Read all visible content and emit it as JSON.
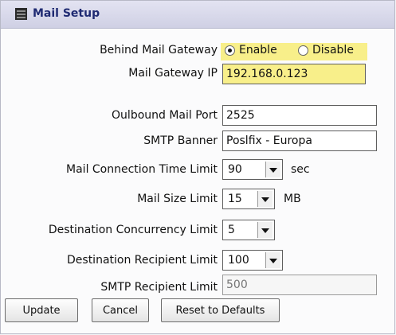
{
  "header": {
    "title": "Mail Setup",
    "icon": "mail-setup-icon"
  },
  "gateway": {
    "label": "Behind Mail Gateway",
    "enable_label": "Enable",
    "disable_label": "Disable",
    "selected": "Enable"
  },
  "fields": {
    "gateway_ip": {
      "label": "Mail Gateway IP",
      "value": "192.168.0.123"
    },
    "outbound_port": {
      "label": "Oulbound Mail Port",
      "value": "2525"
    },
    "smtp_banner": {
      "label": "SMTP Banner",
      "value": "Poslfix - Europa"
    },
    "conn_time": {
      "label": "Mail Connection Time Limit",
      "value": "90",
      "unit": "sec"
    },
    "size_limit": {
      "label": "Mail Size Limit",
      "value": "15",
      "unit": "MB"
    },
    "dest_concurrency": {
      "label": "Destination Concurrency Limit",
      "value": "5"
    },
    "dest_recipient": {
      "label": "Destination Recipient Limit",
      "value": "100"
    },
    "smtp_recipient": {
      "label": "SMTP Recipient Limit",
      "placeholder": "500"
    }
  },
  "buttons": {
    "update": "Update",
    "cancel": "Cancel",
    "reset": "Reset to Defaults"
  },
  "colors": {
    "highlight": "#f8ef8a",
    "header_text": "#1f2a72",
    "header_bg": "#d8d9ea"
  }
}
